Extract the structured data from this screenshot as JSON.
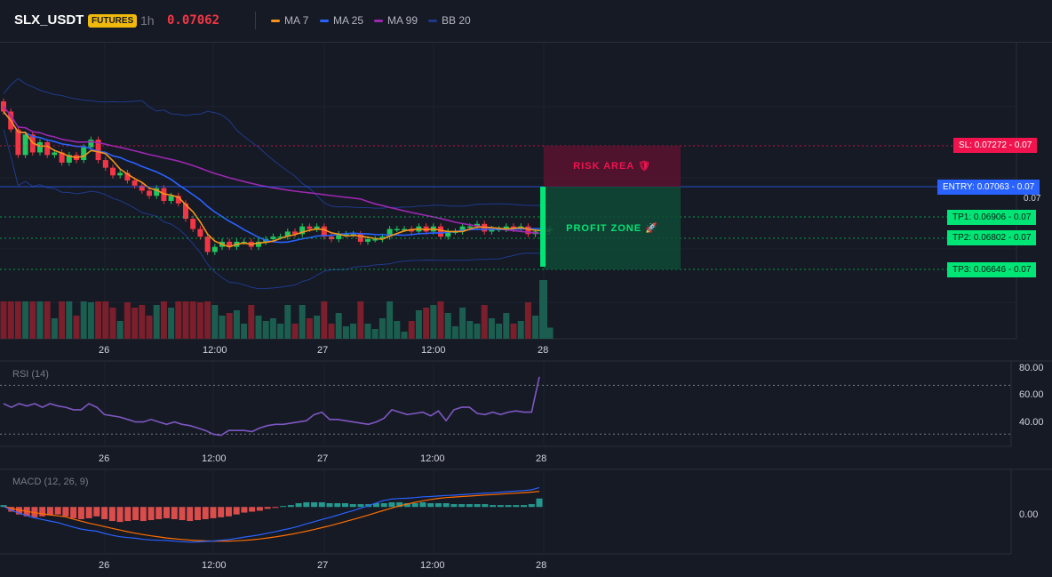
{
  "header": {
    "symbol": "SLX_USDT",
    "badge": "FUTURES",
    "interval": "1h",
    "last_price": "0.07062",
    "legend": [
      {
        "label": "MA 7",
        "color": "#f7931a"
      },
      {
        "label": "MA 25",
        "color": "#2962ff"
      },
      {
        "label": "MA 99",
        "color": "#9c27b0"
      },
      {
        "label": "BB 20",
        "color": "#1e3a8a"
      }
    ]
  },
  "colors": {
    "up": "#26a69a",
    "up_candle": "#22c55e",
    "down": "#f23645",
    "ma7": "#f7931a",
    "ma25": "#2962ff",
    "ma99": "#9c27b0",
    "bb": "#1e3a8a",
    "rsi": "#7e57c2",
    "macd": "#2962ff",
    "signal": "#ff6d00",
    "stop": "#f0134d",
    "target": "#00c853"
  },
  "overlay": {
    "risk_label": "RISK AREA 🛡",
    "profit_label": "PROFIT ZONE 🚀"
  },
  "levels": [
    {
      "key": "sl",
      "label": "SL: 0.07272",
      "value_label": "0.07",
      "price": 0.07272
    },
    {
      "key": "entry",
      "label": "ENTRY: 0.07063",
      "value_label": "0.07",
      "price": 0.07063
    },
    {
      "key": "tp1",
      "label": "TP1: 0.06906",
      "value_label": "0.07",
      "price": 0.06906
    },
    {
      "key": "tp2",
      "label": "TP2: 0.06802",
      "value_label": "0.07",
      "price": 0.06802
    },
    {
      "key": "tp3",
      "label": "TP3: 0.06646",
      "value_label": "0.07",
      "price": 0.06646
    }
  ],
  "price_axis": {
    "last_label": "0.07"
  },
  "time_axis": [
    "26",
    "12:00",
    "27",
    "12:00",
    "28"
  ],
  "rsi": {
    "title": "RSI (14)",
    "axis_labels": [
      "80.00",
      "60.00",
      "40.00"
    ]
  },
  "macd": {
    "title": "MACD (12, 26, 9)",
    "axis_labels": [
      "0.00"
    ]
  },
  "chart_data": {
    "type": "candlestick",
    "price_range": [
      0.0636,
      0.0752
    ],
    "closes": [
      0.0725,
      0.0718,
      0.0708,
      0.0716,
      0.0709,
      0.0713,
      0.0708,
      0.0709,
      0.0705,
      0.0708,
      0.0706,
      0.0711,
      0.0714,
      0.0706,
      0.0703,
      0.07,
      0.0701,
      0.0698,
      0.0696,
      0.0694,
      0.0692,
      0.0695,
      0.069,
      0.0692,
      0.0689,
      0.0683,
      0.0679,
      0.0676,
      0.067,
      0.0672,
      0.0674,
      0.0672,
      0.0674,
      0.0674,
      0.0672,
      0.0674,
      0.0675,
      0.0676,
      0.0676,
      0.0678,
      0.0677,
      0.068,
      0.0679,
      0.068,
      0.0676,
      0.0675,
      0.0677,
      0.0677,
      0.0677,
      0.0674,
      0.0675,
      0.0675,
      0.0676,
      0.0679,
      0.0679,
      0.0679,
      0.0678,
      0.068,
      0.0678,
      0.068,
      0.0676,
      0.0678,
      0.0678,
      0.068,
      0.068,
      0.0681,
      0.0678,
      0.0679,
      0.0679,
      0.068,
      0.0679,
      0.068,
      0.0677,
      0.0678,
      0.06785,
      0.0679
    ],
    "rsi_range": [
      20,
      90
    ],
    "rsi_levels": [
      70,
      30
    ],
    "rsi_values": [
      55,
      52,
      55,
      53,
      55,
      52,
      55,
      53,
      52,
      50,
      50,
      55,
      52,
      46,
      45,
      44,
      42,
      40,
      40,
      42,
      40,
      38,
      40,
      38,
      37,
      35,
      33,
      30,
      29,
      33,
      33,
      33,
      32,
      35,
      37,
      38,
      38,
      39,
      40,
      41,
      46,
      48,
      42,
      42,
      41,
      40,
      39,
      38,
      40,
      43,
      50,
      48,
      46,
      47,
      48,
      45,
      49,
      41,
      50,
      52,
      52,
      47,
      46,
      48,
      46,
      48,
      49,
      48,
      48,
      77
    ],
    "macd_range": [
      -0.0005,
      0.0004
    ],
    "histogram": [
      2e-05,
      -5e-05,
      -8e-05,
      -0.0001,
      -0.00011,
      -0.0001,
      -9e-05,
      -8e-05,
      -0.0001,
      -0.00012,
      -0.00013,
      -0.00012,
      -0.0001,
      -0.00013,
      -0.00015,
      -0.00016,
      -0.00015,
      -0.00014,
      -0.00015,
      -0.00014,
      -0.00013,
      -0.00012,
      -0.00013,
      -0.00014,
      -0.00015,
      -0.00014,
      -0.00013,
      -0.00012,
      -0.00011,
      -0.0001,
      -8e-05,
      -6e-05,
      -5e-05,
      -4e-05,
      -2e-05,
      -1e-05,
      1e-05,
      2e-05,
      4e-05,
      5e-05,
      5e-05,
      5e-05,
      4e-05,
      4e-05,
      4e-05,
      3e-05,
      3e-05,
      3e-05,
      4e-05,
      4e-05,
      5e-05,
      5e-05,
      4e-05,
      4e-05,
      5e-05,
      4e-05,
      4e-05,
      4e-05,
      3e-05,
      3e-05,
      3e-05,
      3e-05,
      3e-05,
      2e-05,
      2e-05,
      2e-05,
      2e-05,
      2e-05,
      3e-05,
      9e-05
    ]
  }
}
